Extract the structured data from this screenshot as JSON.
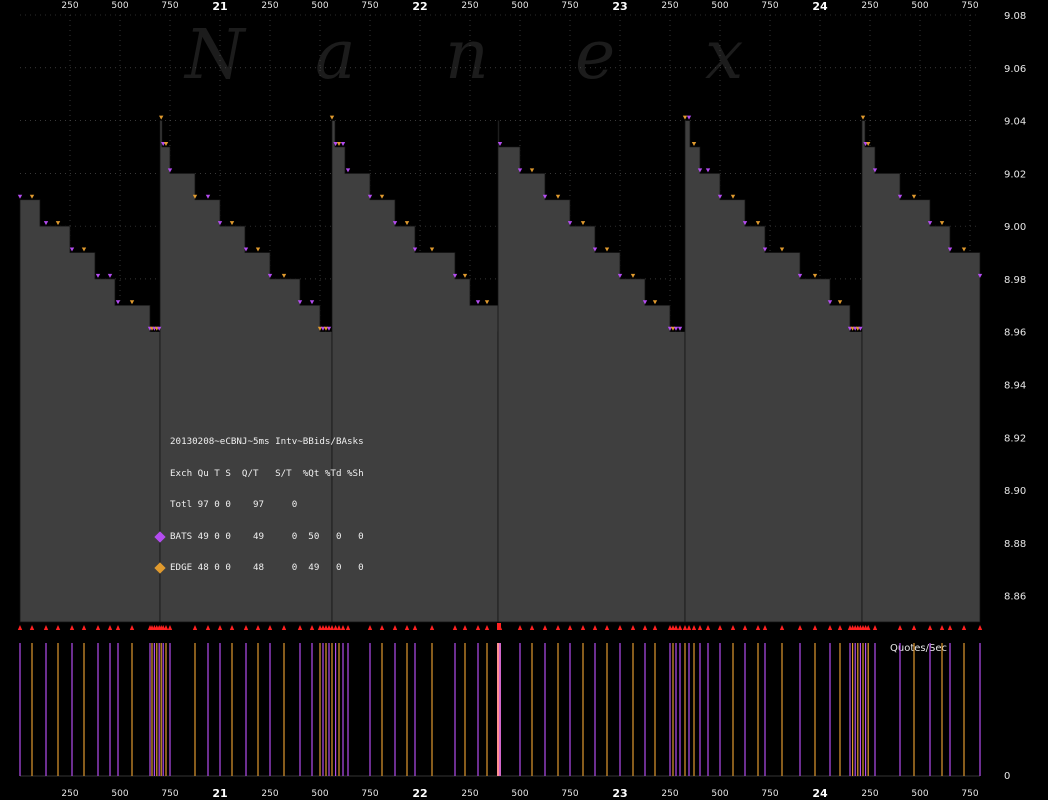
{
  "watermark": "Nanex",
  "colors": {
    "background": "#000000",
    "area_fill": "#3f3f3f",
    "bats": "#b44cf0",
    "edge": "#e09a2e",
    "trade_marker": "#ff2020",
    "grid": "#5a5a5a",
    "burst": "#ff9090"
  },
  "stats": {
    "title": "20130208~eCBNJ~5ms Intv~BBids/BAsks",
    "header": "Exch Qu T S  Q/T   S/T  %Qt %Td %Sh",
    "rows": [
      {
        "name": "totl",
        "text": "Totl 97 0 0    97     0",
        "color": ""
      },
      {
        "name": "bats",
        "text": "BATS 49 0 0    49     0  50   0   0",
        "color": "#b44cf0"
      },
      {
        "name": "edge",
        "text": "EDGE 48 0 0    48     0  49   0   0",
        "color": "#e09a2e"
      }
    ]
  },
  "bottom_panel": {
    "label": "Quotes/Sec",
    "zero_label": "0"
  },
  "chart_data": {
    "type": "area",
    "description_units": "x = milliseconds within seconds 20 through 24; y = price",
    "x_ticks": [
      {
        "label": "250",
        "x": 20250,
        "major": false
      },
      {
        "label": "500",
        "x": 20500,
        "major": false
      },
      {
        "label": "750",
        "x": 20750,
        "major": false
      },
      {
        "label": "21",
        "x": 21000,
        "major": true
      },
      {
        "label": "250",
        "x": 21250,
        "major": false
      },
      {
        "label": "500",
        "x": 21500,
        "major": false
      },
      {
        "label": "750",
        "x": 21750,
        "major": false
      },
      {
        "label": "22",
        "x": 22000,
        "major": true
      },
      {
        "label": "250",
        "x": 22250,
        "major": false
      },
      {
        "label": "500",
        "x": 22500,
        "major": false
      },
      {
        "label": "750",
        "x": 22750,
        "major": false
      },
      {
        "label": "23",
        "x": 23000,
        "major": true
      },
      {
        "label": "250",
        "x": 23250,
        "major": false
      },
      {
        "label": "500",
        "x": 23500,
        "major": false
      },
      {
        "label": "750",
        "x": 23750,
        "major": false
      },
      {
        "label": "24",
        "x": 24000,
        "major": true
      },
      {
        "label": "250",
        "x": 24250,
        "major": false
      },
      {
        "label": "500",
        "x": 24500,
        "major": false
      },
      {
        "label": "750",
        "x": 24750,
        "major": false
      }
    ],
    "xlim": [
      20000,
      24800
    ],
    "y_ticks": [
      "9.08",
      "9.06",
      "9.04",
      "9.02",
      "9.00",
      "8.98",
      "8.96",
      "8.94",
      "8.92",
      "8.90",
      "8.88",
      "8.86"
    ],
    "ylim": [
      8.85,
      9.08
    ],
    "grid": true,
    "cycles": [
      {
        "start": 20000,
        "steps": [
          [
            20000,
            9.01
          ],
          [
            20100,
            9.0
          ],
          [
            20250,
            8.99
          ],
          [
            20375,
            8.98
          ],
          [
            20475,
            8.97
          ],
          [
            20650,
            8.96
          ]
        ]
      },
      {
        "start": 20700,
        "steps": [
          [
            20700,
            9.04
          ],
          [
            20710,
            9.03
          ],
          [
            20750,
            9.02
          ],
          [
            20875,
            9.01
          ],
          [
            21000,
            9.0
          ],
          [
            21125,
            8.99
          ],
          [
            21250,
            8.98
          ],
          [
            21400,
            8.97
          ],
          [
            21500,
            8.96
          ]
        ]
      },
      {
        "start": 21560,
        "steps": [
          [
            21560,
            9.04
          ],
          [
            21575,
            9.03
          ],
          [
            21625,
            9.02
          ],
          [
            21750,
            9.01
          ],
          [
            21875,
            9.0
          ],
          [
            21975,
            8.99
          ],
          [
            22175,
            8.98
          ],
          [
            22250,
            8.97
          ],
          [
            22400,
            8.96
          ]
        ]
      },
      {
        "start": 22390,
        "steps": [
          [
            22390,
            9.04
          ],
          [
            22395,
            9.03
          ],
          [
            22500,
            9.02
          ],
          [
            22625,
            9.01
          ],
          [
            22750,
            9.0
          ],
          [
            22875,
            8.99
          ],
          [
            23000,
            8.98
          ],
          [
            23125,
            8.97
          ],
          [
            23250,
            8.96
          ]
        ]
      },
      {
        "start": 23325,
        "steps": [
          [
            23325,
            9.04
          ],
          [
            23350,
            9.03
          ],
          [
            23400,
            9.02
          ],
          [
            23500,
            9.01
          ],
          [
            23625,
            9.0
          ],
          [
            23725,
            8.99
          ],
          [
            23900,
            8.98
          ],
          [
            24050,
            8.97
          ],
          [
            24150,
            8.96
          ]
        ]
      },
      {
        "start": 24210,
        "steps": [
          [
            24210,
            9.04
          ],
          [
            24225,
            9.03
          ],
          [
            24275,
            9.02
          ],
          [
            24400,
            9.01
          ],
          [
            24550,
            9.0
          ],
          [
            24650,
            8.99
          ],
          [
            24800,
            8.98
          ]
        ]
      }
    ],
    "quote_events": [
      {
        "t": 20000,
        "ex": "bats"
      },
      {
        "t": 20060,
        "ex": "edge"
      },
      {
        "t": 20130,
        "ex": "bats"
      },
      {
        "t": 20190,
        "ex": "edge"
      },
      {
        "t": 20260,
        "ex": "bats"
      },
      {
        "t": 20320,
        "ex": "edge"
      },
      {
        "t": 20390,
        "ex": "bats"
      },
      {
        "t": 20450,
        "ex": "bats"
      },
      {
        "t": 20490,
        "ex": "bats"
      },
      {
        "t": 20560,
        "ex": "edge"
      },
      {
        "t": 20650,
        "ex": "bats"
      },
      {
        "t": 20660,
        "ex": "edge"
      },
      {
        "t": 20672,
        "ex": "bats"
      },
      {
        "t": 20684,
        "ex": "edge"
      },
      {
        "t": 20696,
        "ex": "bats"
      },
      {
        "t": 20706,
        "ex": "edge"
      },
      {
        "t": 20716,
        "ex": "bats"
      },
      {
        "t": 20730,
        "ex": "edge"
      },
      {
        "t": 20750,
        "ex": "bats"
      },
      {
        "t": 20875,
        "ex": "edge"
      },
      {
        "t": 20940,
        "ex": "bats"
      },
      {
        "t": 21000,
        "ex": "bats"
      },
      {
        "t": 21060,
        "ex": "edge"
      },
      {
        "t": 21130,
        "ex": "bats"
      },
      {
        "t": 21190,
        "ex": "edge"
      },
      {
        "t": 21250,
        "ex": "bats"
      },
      {
        "t": 21320,
        "ex": "edge"
      },
      {
        "t": 21400,
        "ex": "bats"
      },
      {
        "t": 21460,
        "ex": "bats"
      },
      {
        "t": 21500,
        "ex": "edge"
      },
      {
        "t": 21515,
        "ex": "bats"
      },
      {
        "t": 21530,
        "ex": "edge"
      },
      {
        "t": 21545,
        "ex": "bats"
      },
      {
        "t": 21560,
        "ex": "edge"
      },
      {
        "t": 21578,
        "ex": "bats"
      },
      {
        "t": 21595,
        "ex": "edge"
      },
      {
        "t": 21615,
        "ex": "bats"
      },
      {
        "t": 21640,
        "ex": "bats"
      },
      {
        "t": 21750,
        "ex": "bats"
      },
      {
        "t": 21810,
        "ex": "edge"
      },
      {
        "t": 21875,
        "ex": "bats"
      },
      {
        "t": 21935,
        "ex": "edge"
      },
      {
        "t": 21975,
        "ex": "bats"
      },
      {
        "t": 22060,
        "ex": "edge"
      },
      {
        "t": 22175,
        "ex": "bats"
      },
      {
        "t": 22225,
        "ex": "edge"
      },
      {
        "t": 22290,
        "ex": "bats"
      },
      {
        "t": 22335,
        "ex": "edge"
      },
      {
        "t": 22400,
        "ex": "bats"
      },
      {
        "t": 22500,
        "ex": "bats"
      },
      {
        "t": 22560,
        "ex": "edge"
      },
      {
        "t": 22625,
        "ex": "bats"
      },
      {
        "t": 22690,
        "ex": "edge"
      },
      {
        "t": 22750,
        "ex": "bats"
      },
      {
        "t": 22815,
        "ex": "edge"
      },
      {
        "t": 22875,
        "ex": "bats"
      },
      {
        "t": 22935,
        "ex": "edge"
      },
      {
        "t": 23000,
        "ex": "bats"
      },
      {
        "t": 23065,
        "ex": "edge"
      },
      {
        "t": 23125,
        "ex": "bats"
      },
      {
        "t": 23175,
        "ex": "edge"
      },
      {
        "t": 23250,
        "ex": "bats"
      },
      {
        "t": 23265,
        "ex": "edge"
      },
      {
        "t": 23280,
        "ex": "bats"
      },
      {
        "t": 23300,
        "ex": "bats"
      },
      {
        "t": 23325,
        "ex": "edge"
      },
      {
        "t": 23345,
        "ex": "bats"
      },
      {
        "t": 23370,
        "ex": "edge"
      },
      {
        "t": 23400,
        "ex": "bats"
      },
      {
        "t": 23440,
        "ex": "bats"
      },
      {
        "t": 23500,
        "ex": "bats"
      },
      {
        "t": 23565,
        "ex": "edge"
      },
      {
        "t": 23625,
        "ex": "bats"
      },
      {
        "t": 23690,
        "ex": "edge"
      },
      {
        "t": 23725,
        "ex": "bats"
      },
      {
        "t": 23810,
        "ex": "edge"
      },
      {
        "t": 23900,
        "ex": "bats"
      },
      {
        "t": 23975,
        "ex": "edge"
      },
      {
        "t": 24050,
        "ex": "bats"
      },
      {
        "t": 24100,
        "ex": "edge"
      },
      {
        "t": 24150,
        "ex": "bats"
      },
      {
        "t": 24163,
        "ex": "edge"
      },
      {
        "t": 24176,
        "ex": "bats"
      },
      {
        "t": 24189,
        "ex": "edge"
      },
      {
        "t": 24202,
        "ex": "bats"
      },
      {
        "t": 24215,
        "ex": "edge"
      },
      {
        "t": 24228,
        "ex": "bats"
      },
      {
        "t": 24241,
        "ex": "edge"
      },
      {
        "t": 24275,
        "ex": "bats"
      },
      {
        "t": 24400,
        "ex": "bats"
      },
      {
        "t": 24470,
        "ex": "edge"
      },
      {
        "t": 24550,
        "ex": "bats"
      },
      {
        "t": 24610,
        "ex": "edge"
      },
      {
        "t": 24650,
        "ex": "bats"
      },
      {
        "t": 24720,
        "ex": "edge"
      },
      {
        "t": 24800,
        "ex": "bats"
      }
    ],
    "burst": {
      "start": 22385,
      "end": 22405
    }
  }
}
